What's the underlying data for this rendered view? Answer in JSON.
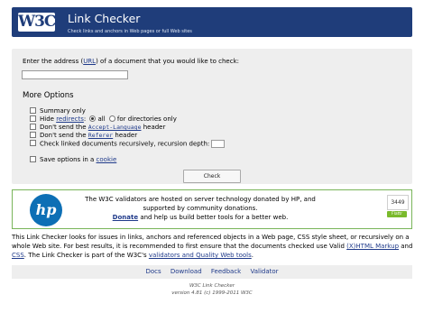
{
  "header": {
    "logo_text": "W3C",
    "logo_reg": "®",
    "title": "Link Checker",
    "subtitle": "Check links and anchors in Web pages or full Web sites"
  },
  "form": {
    "prompt_before": "Enter the address (",
    "prompt_link": "URL",
    "prompt_after": ") of a document that you would like to check:",
    "uri_value": "",
    "more_options": "More Options",
    "summary_only": "Summary only",
    "hide_before": "Hide ",
    "hide_link": "redirects",
    "hide_after": ":",
    "hide_all": "all",
    "hide_dirs": "for directories only",
    "accept_lang_before": "Don't send the ",
    "accept_lang_code": "Accept-Language",
    "accept_lang_after": " header",
    "referer_before": "Don't send the ",
    "referer_code": "Referer",
    "referer_after": " header",
    "recursive_label": "Check linked documents recursively, recursion depth:",
    "save_before": "Save options in a ",
    "save_link": "cookie",
    "check_button": "Check"
  },
  "sponsor": {
    "logo": "hp",
    "line1": "The W3C validators are hosted on server technology donated by HP, and supported by community donations.",
    "donate": "Donate",
    "line2": " and help us build better tools for a better web.",
    "flattr_count": "3449",
    "flattr_label": "Flattr"
  },
  "intro": {
    "part1": "This Link Checker looks for issues in links, anchors and referenced objects in a Web page, CSS style sheet, or recursively on a whole Web site. For best results, it is recommended to first ensure that the documents checked use Valid ",
    "markup_link": "(X)HTML Markup",
    "part2": " and ",
    "css_link": "CSS",
    "part3": ". The Link Checker is part of the W3C's ",
    "tools_link": "validators and Quality Web tools",
    "part4": "."
  },
  "nav": {
    "docs": "Docs",
    "download": "Download",
    "feedback": "Feedback",
    "validator": "Validator"
  },
  "footer": {
    "line1": "W3C Link Checker",
    "line2": "version 4.81 (c) 1999-2011 W3C"
  },
  "colors": {
    "banner": "#1f3d7a",
    "panel": "#eeeeee",
    "sponsor_border": "#79b559",
    "hp_blue": "#0d6fb5",
    "link": "#1f3a8a"
  }
}
